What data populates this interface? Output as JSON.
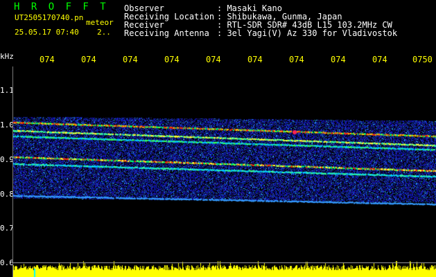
{
  "header": {
    "app_title": "H R O F F T",
    "filename": "UT2505170740.pn",
    "tag": "meteor",
    "datetime": "25.05.17 07:40",
    "count": "2.."
  },
  "info": [
    {
      "label": "Observer",
      "value": ": Masaki Kano"
    },
    {
      "label": "Receiving Location",
      "value": ": Shibukawa, Gunma, Japan"
    },
    {
      "label": "Receiver",
      "value": ": RTL-SDR SDR# 43dB L15 103.2MHz CW"
    },
    {
      "label": "Receiving Antenna",
      "value": ": 3el Yagi(V) Az 330 for Vladivostok"
    }
  ],
  "time_ticks": [
    "074",
    "074",
    "074",
    "074",
    "074",
    "074",
    "074",
    "074",
    "074",
    "0750"
  ],
  "freq_axis": {
    "unit": "kHz",
    "labels": [
      "1.1",
      "1.0",
      "0.9",
      "0.8",
      "0.7",
      "0.6"
    ]
  },
  "colors": {
    "background": "#000000",
    "title": "#00ff00",
    "label": "#ffff00",
    "text": "#ffffff",
    "signal": "#ffff00"
  }
}
